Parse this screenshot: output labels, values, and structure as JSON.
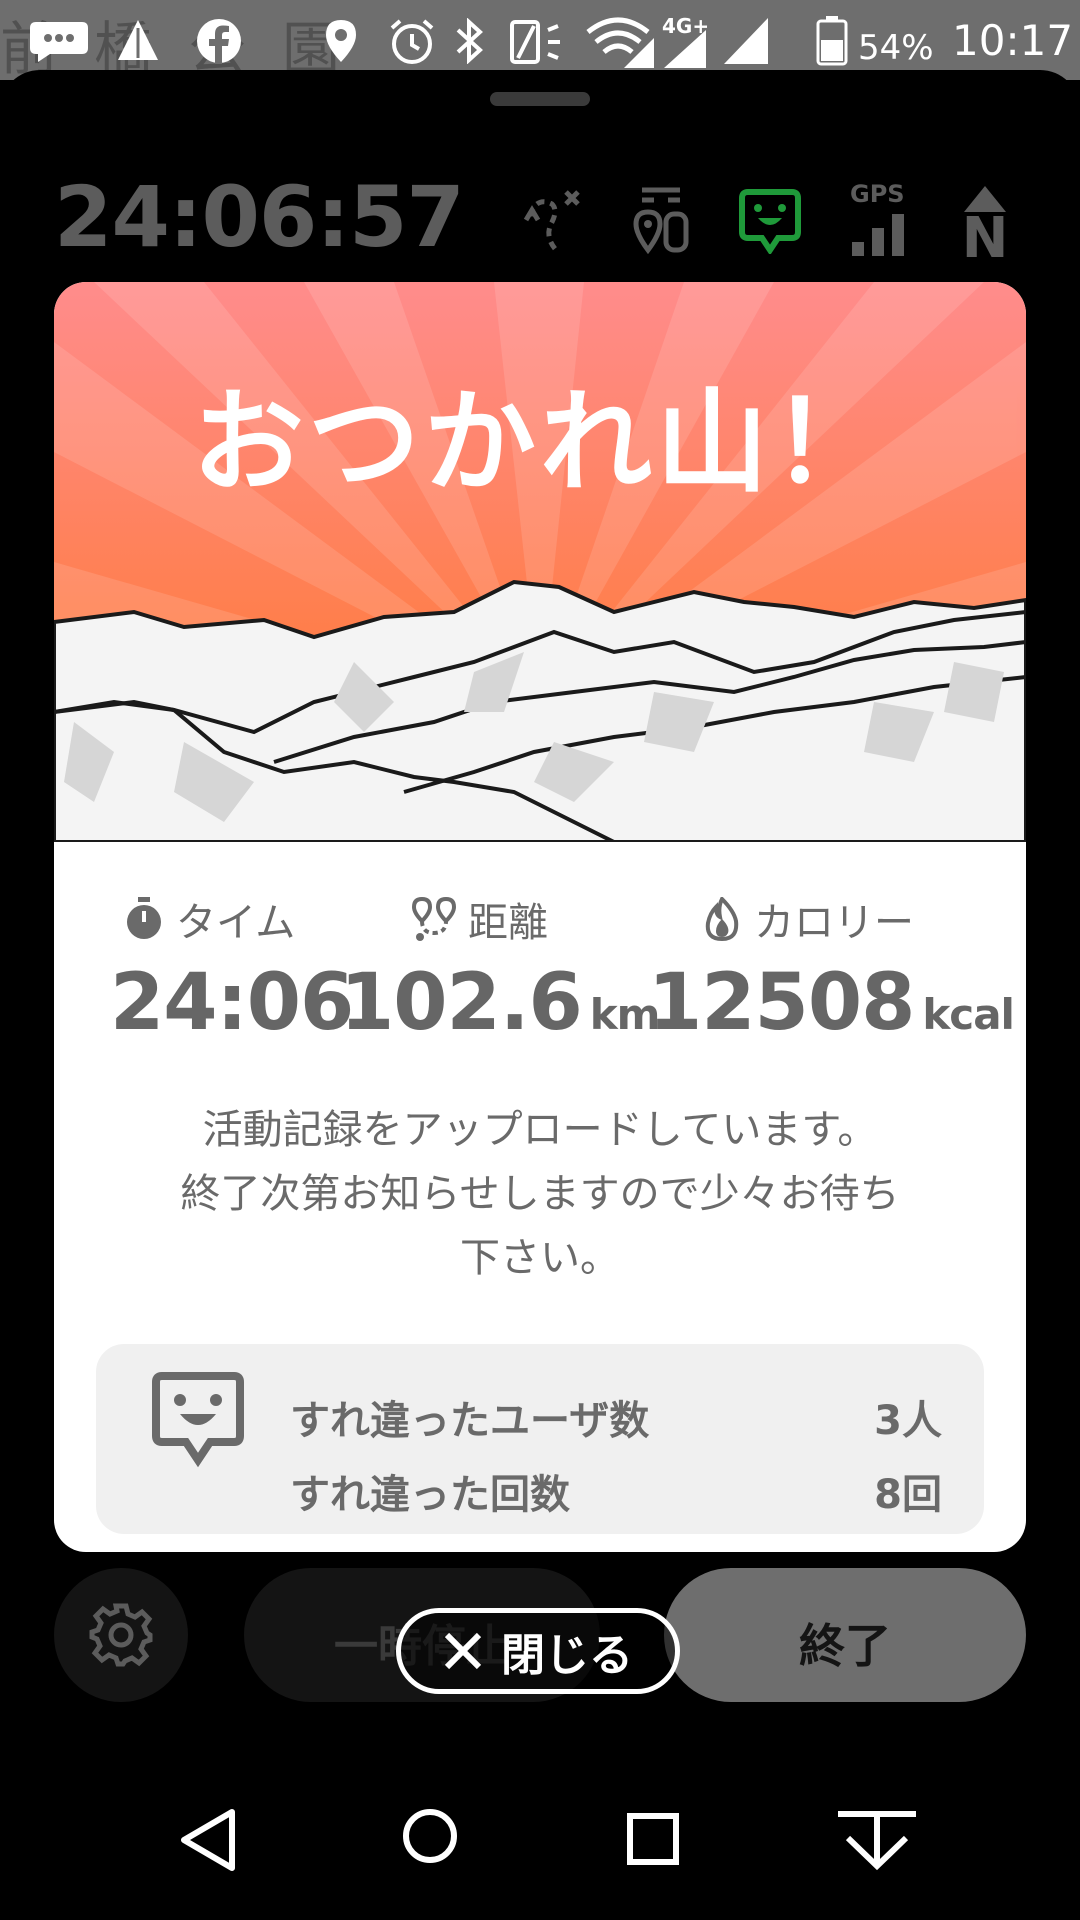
{
  "status_bar": {
    "map_text": "前橋公園",
    "network": "4G+",
    "battery_percent": "54%",
    "clock": "10:17",
    "icons": [
      "messages-icon",
      "alert-icon",
      "facebook-icon",
      "location-icon",
      "alarm-icon",
      "bluetooth-icon",
      "vibrate-icon",
      "wifi-icon",
      "signal-icon",
      "signal-icon",
      "battery-icon"
    ]
  },
  "tracker": {
    "elapsed": "24:06:57",
    "icons": [
      "route-off-icon",
      "checkpoint-icon",
      "encounter-icon",
      "gps-signal-icon",
      "compass-north-icon"
    ],
    "gps_label": "GPS",
    "north_label": "N",
    "active_color": "#1f9a3a"
  },
  "modal": {
    "title": "おつかれ山！",
    "stats": [
      {
        "icon": "stopwatch-icon",
        "label": "タイム",
        "value": "24:06",
        "unit": ""
      },
      {
        "icon": "route-icon",
        "label": "距離",
        "value": "102.6",
        "unit": "km"
      },
      {
        "icon": "flame-icon",
        "label": "カロリー",
        "value": "12508",
        "unit": "kcal"
      }
    ],
    "message_lines": [
      "活動記録をアップロードしています。",
      "終了次第お知らせしますので少々お待ち",
      "下さい。"
    ],
    "encounter": {
      "icon": "encounter-icon",
      "rows": [
        {
          "label": "すれ違ったユーザ数",
          "value": "3人"
        },
        {
          "label": "すれ違った回数",
          "value": "8回"
        }
      ]
    },
    "colors": {
      "sky_top": "#ff8b8b",
      "sky_bottom": "#ff7a22"
    }
  },
  "controls": {
    "pause_label": "一時停止",
    "end_label": "終了",
    "close_label": "閉じる"
  },
  "navbar": [
    "back-icon",
    "home-icon",
    "recents-icon",
    "hide-icon"
  ]
}
